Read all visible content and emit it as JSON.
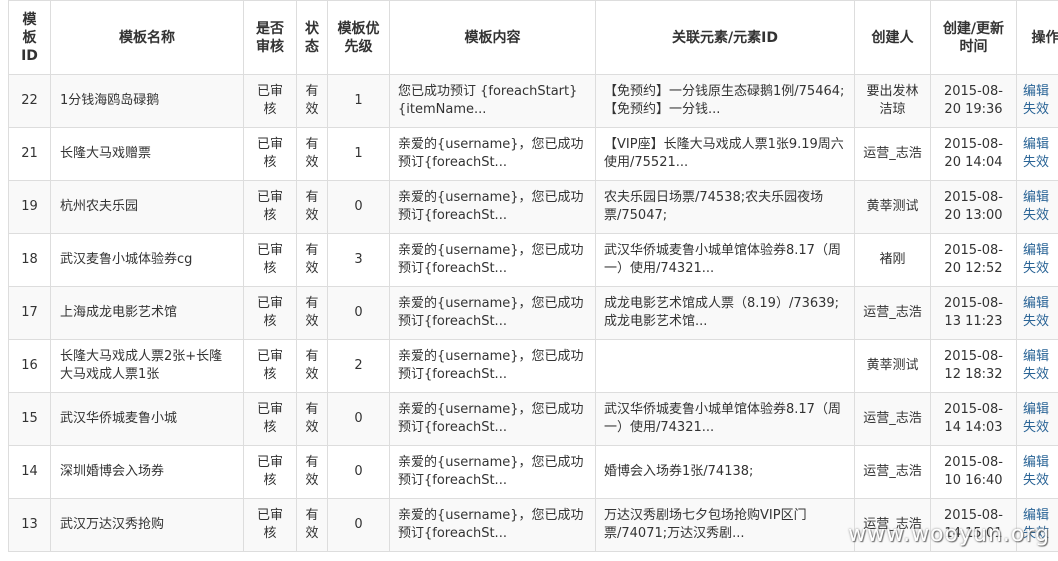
{
  "table": {
    "headers": {
      "id": "模板ID",
      "name": "模板名称",
      "audited": "是否审核",
      "status": "状态",
      "priority": "模板优先级",
      "content": "模板内容",
      "related": "关联元素/元素ID",
      "creator": "创建人",
      "time": "创建/更新时间",
      "ops": "操作"
    },
    "rows": [
      {
        "id": "22",
        "name": "1分钱海鸥岛碌鹅",
        "audited": "已审核",
        "status": "有效",
        "priority": "1",
        "content": "您已成功预订 {foreachStart}{itemName...",
        "related": "【免预约】一分钱原生态碌鹅1例/75464;【免预约】一分钱...",
        "creator": "要出发林洁琼",
        "time": "2015-08-20 19:36",
        "edit": "编辑",
        "disable": "失效"
      },
      {
        "id": "21",
        "name": "长隆大马戏赠票",
        "audited": "已审核",
        "status": "有效",
        "priority": "1",
        "content": "亲爱的{username}，您已成功预订{foreachSt...",
        "related": "【VIP座】长隆大马戏成人票1张9.19周六使用/75521...",
        "creator": "运营_志浩",
        "time": "2015-08-20 14:04",
        "edit": "编辑",
        "disable": "失效"
      },
      {
        "id": "19",
        "name": "杭州农夫乐园",
        "audited": "已审核",
        "status": "有效",
        "priority": "0",
        "content": "亲爱的{username}，您已成功预订{foreachSt...",
        "related": "农夫乐园日场票/74538;农夫乐园夜场票/75047;",
        "creator": "黄莘测试",
        "time": "2015-08-20 13:00",
        "edit": "编辑",
        "disable": "失效"
      },
      {
        "id": "18",
        "name": "武汉麦鲁小城体验券cg",
        "audited": "已审核",
        "status": "有效",
        "priority": "3",
        "content": "亲爱的{username}，您已成功预订{foreachSt...",
        "related": "武汉华侨城麦鲁小城单馆体验券8.17（周一）使用/74321...",
        "creator": "褚刚",
        "time": "2015-08-20 12:52",
        "edit": "编辑",
        "disable": "失效"
      },
      {
        "id": "17",
        "name": "上海成龙电影艺术馆",
        "audited": "已审核",
        "status": "有效",
        "priority": "0",
        "content": "亲爱的{username}，您已成功预订{foreachSt...",
        "related": "成龙电影艺术馆成人票（8.19）/73639;成龙电影艺术馆...",
        "creator": "运营_志浩",
        "time": "2015-08-13 11:23",
        "edit": "编辑",
        "disable": "失效"
      },
      {
        "id": "16",
        "name": "长隆大马戏成人票2张+长隆大马戏成人票1张",
        "audited": "已审核",
        "status": "有效",
        "priority": "2",
        "content": "亲爱的{username}，您已成功预订{foreachSt...",
        "related": "",
        "creator": "黄莘测试",
        "time": "2015-08-12 18:32",
        "edit": "编辑",
        "disable": "失效"
      },
      {
        "id": "15",
        "name": "武汉华侨城麦鲁小城",
        "audited": "已审核",
        "status": "有效",
        "priority": "0",
        "content": "亲爱的{username}，您已成功预订{foreachSt...",
        "related": "武汉华侨城麦鲁小城单馆体验券8.17（周一）使用/74321...",
        "creator": "运营_志浩",
        "time": "2015-08-14 14:03",
        "edit": "编辑",
        "disable": "失效"
      },
      {
        "id": "14",
        "name": "深圳婚博会入场券",
        "audited": "已审核",
        "status": "有效",
        "priority": "0",
        "content": "亲爱的{username}，您已成功预订{foreachSt...",
        "related": "婚博会入场券1张/74138;",
        "creator": "运营_志浩",
        "time": "2015-08-10 16:40",
        "edit": "编辑",
        "disable": "失效"
      },
      {
        "id": "13",
        "name": "武汉万达汉秀抢购",
        "audited": "已审核",
        "status": "有效",
        "priority": "0",
        "content": "亲爱的{username}，您已成功预订{foreachSt...",
        "related": "万达汉秀剧场七夕包场抢购VIP区门票/74071;万达汉秀剧...",
        "creator": "运营_志浩",
        "time": "2015-08-14 15:01",
        "edit": "编辑",
        "disable": "失效"
      }
    ]
  },
  "watermark": "www.wooyun.org"
}
